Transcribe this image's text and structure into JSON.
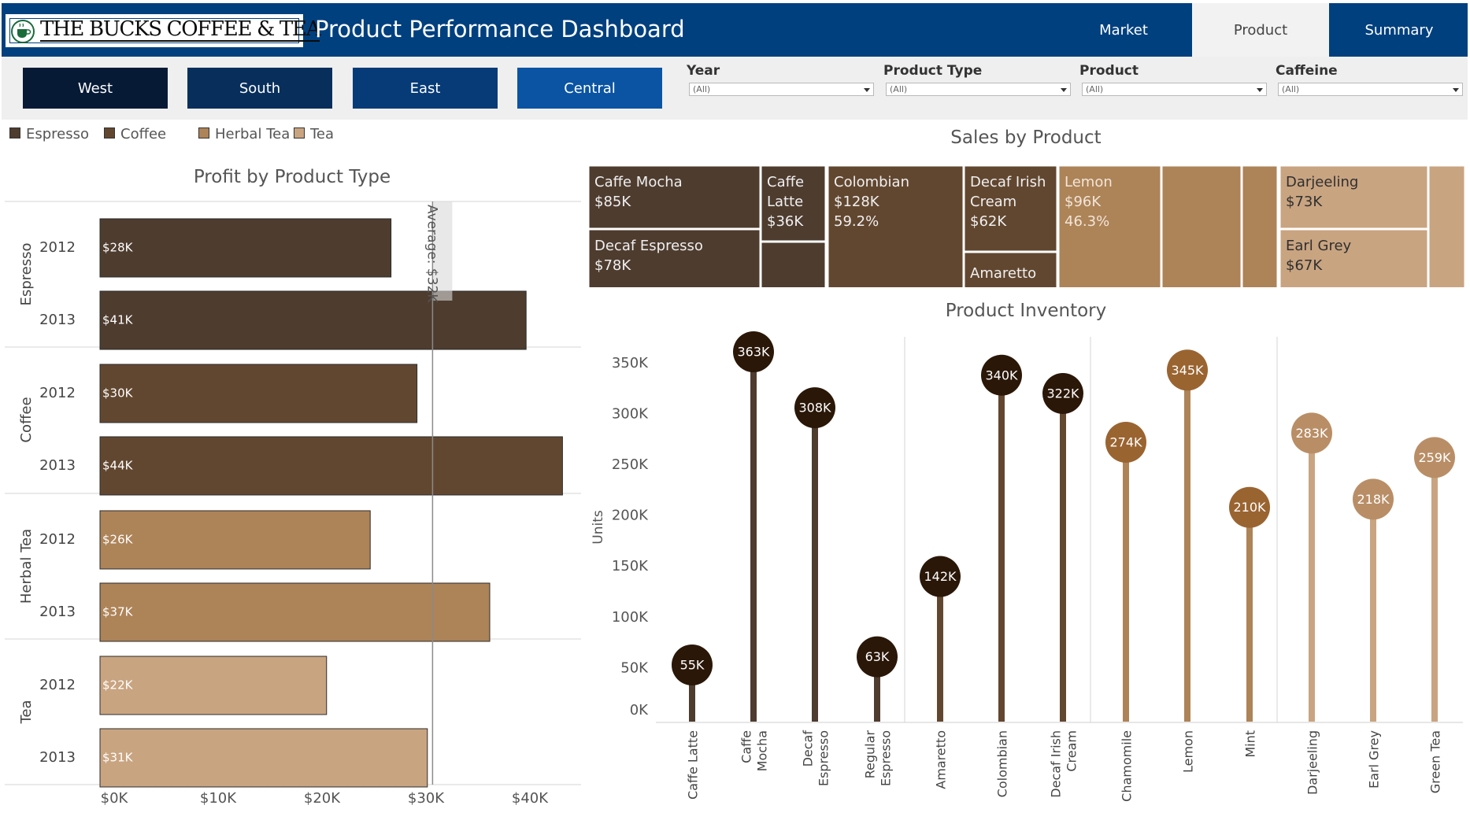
{
  "header": {
    "logo_text": "THE BUCKS COFFEE & TEA",
    "title": "Product Performance Dashboard",
    "tabs": [
      {
        "label": "Market",
        "active": false
      },
      {
        "label": "Product",
        "active": true
      },
      {
        "label": "Summary",
        "active": false
      }
    ]
  },
  "regions": [
    {
      "label": "West",
      "color": "#061a36"
    },
    {
      "label": "South",
      "color": "#082f5c"
    },
    {
      "label": "East",
      "color": "#063b78"
    },
    {
      "label": "Central",
      "color": "#0a54a3"
    }
  ],
  "filters": [
    {
      "label": "Year",
      "value": "(All)"
    },
    {
      "label": "Product Type",
      "value": "(All)"
    },
    {
      "label": "Product",
      "value": "(All)"
    },
    {
      "label": "Caffeine",
      "value": "(All)"
    }
  ],
  "legend": [
    {
      "label": "Espresso",
      "color": "#4e3c2f"
    },
    {
      "label": "Coffee",
      "color": "#624730"
    },
    {
      "label": "Herbal Tea",
      "color": "#ad8358"
    },
    {
      "label": "Tea",
      "color": "#c9a481"
    }
  ],
  "profit_chart": {
    "title": "Profit by Product Type",
    "average_label": "Average: $32K",
    "average_value": 32,
    "x_ticks": [
      "$0K",
      "$10K",
      "$20K",
      "$30K",
      "$40K"
    ],
    "x_tick_values": [
      0,
      10,
      20,
      30,
      40
    ],
    "groups": [
      {
        "name": "Espresso",
        "color": "#4e3c2f",
        "rows": [
          {
            "year": "2012",
            "value": 28,
            "label": "$28K"
          },
          {
            "year": "2013",
            "value": 41,
            "label": "$41K"
          }
        ]
      },
      {
        "name": "Coffee",
        "color": "#624730",
        "rows": [
          {
            "year": "2012",
            "value": 30.5,
            "label": "$30K"
          },
          {
            "year": "2013",
            "value": 44.5,
            "label": "$44K"
          }
        ]
      },
      {
        "name": "Herbal Tea",
        "color": "#ad8358",
        "rows": [
          {
            "year": "2012",
            "value": 26,
            "label": "$26K"
          },
          {
            "year": "2013",
            "value": 37.5,
            "label": "$37K"
          }
        ]
      },
      {
        "name": "Tea",
        "color": "#c9a481",
        "rows": [
          {
            "year": "2012",
            "value": 21.8,
            "label": "$22K"
          },
          {
            "year": "2013",
            "value": 31.5,
            "label": "$31K"
          }
        ]
      }
    ]
  },
  "sales_chart": {
    "title": "Sales by Product",
    "cells": [
      {
        "name": "Caffe Mocha",
        "value": "$85K",
        "extra": "",
        "color": "#4e3c2f"
      },
      {
        "name": "Decaf Espresso",
        "value": "$78K",
        "extra": "",
        "color": "#4e3c2f"
      },
      {
        "name": "Caffe Latte",
        "value": "$36K",
        "extra": "",
        "color": "#4e3c2f"
      },
      {
        "name": "",
        "value": "",
        "extra": "",
        "color": "#4e3c2f"
      },
      {
        "name": "Colombian",
        "value": "$128K",
        "extra": "59.2%",
        "color": "#624730"
      },
      {
        "name": "Decaf Irish Cream",
        "value": "$62K",
        "extra": "",
        "color": "#624730"
      },
      {
        "name": "Amaretto",
        "value": "",
        "extra": "",
        "color": "#624730"
      },
      {
        "name": "Lemon",
        "value": "$96K",
        "extra": "46.3%",
        "color": "#ad8358"
      },
      {
        "name": "",
        "value": "",
        "extra": "",
        "color": "#ad8358"
      },
      {
        "name": "",
        "value": "",
        "extra": "",
        "color": "#ad8358"
      },
      {
        "name": "Darjeeling",
        "value": "$73K",
        "extra": "",
        "color": "#c9a481"
      },
      {
        "name": "Earl Grey",
        "value": "$67K",
        "extra": "",
        "color": "#c9a481"
      },
      {
        "name": "",
        "value": "",
        "extra": "",
        "color": "#c9a481"
      }
    ]
  },
  "chart_data": {
    "type": "scatter",
    "title": "Product Inventory",
    "ylabel": "Units",
    "ylim": [
      0,
      370000
    ],
    "y_ticks": [
      "0K",
      "50K",
      "100K",
      "150K",
      "200K",
      "250K",
      "300K",
      "350K"
    ],
    "y_tick_values": [
      0,
      50000,
      100000,
      150000,
      200000,
      250000,
      300000,
      350000
    ],
    "grid": false,
    "series": [
      {
        "category": "Espresso",
        "stem_color": "#4e3c2f",
        "points": [
          {
            "x": "Caffe Latte",
            "value": 55000,
            "label": "55K",
            "dot": "#2a1708"
          },
          {
            "x": "Caffe Mocha",
            "value": 363000,
            "label": "363K",
            "dot": "#2a1708"
          },
          {
            "x": "Decaf Espresso",
            "value": 308000,
            "label": "308K",
            "dot": "#2a1708"
          },
          {
            "x": "Regular Espresso",
            "value": 63000,
            "label": "63K",
            "dot": "#2a1708"
          }
        ]
      },
      {
        "category": "Coffee",
        "stem_color": "#624730",
        "points": [
          {
            "x": "Amaretto",
            "value": 142000,
            "label": "142K",
            "dot": "#2a1708"
          },
          {
            "x": "Colombian",
            "value": 340000,
            "label": "340K",
            "dot": "#2a1708"
          },
          {
            "x": "Decaf Irish Cream",
            "value": 322000,
            "label": "322K",
            "dot": "#2a1708"
          }
        ]
      },
      {
        "category": "Herbal Tea",
        "stem_color": "#ad8358",
        "points": [
          {
            "x": "Chamomile",
            "value": 274000,
            "label": "274K",
            "dot": "#9a6431"
          },
          {
            "x": "Lemon",
            "value": 345000,
            "label": "345K",
            "dot": "#9a6431"
          },
          {
            "x": "Mint",
            "value": 210000,
            "label": "210K",
            "dot": "#9a6431"
          }
        ]
      },
      {
        "category": "Tea",
        "stem_color": "#c9a481",
        "points": [
          {
            "x": "Darjeeling",
            "value": 283000,
            "label": "283K",
            "dot": "#b98e66"
          },
          {
            "x": "Earl Grey",
            "value": 218000,
            "label": "218K",
            "dot": "#b98e66"
          },
          {
            "x": "Green Tea",
            "value": 259000,
            "label": "259K",
            "dot": "#b98e66"
          }
        ]
      }
    ],
    "x_labels": [
      [
        "Caffe Latte"
      ],
      [
        "Caffe",
        "Mocha"
      ],
      [
        "Decaf",
        "Espresso"
      ],
      [
        "Regular",
        "Espresso"
      ],
      [
        "Amaretto"
      ],
      [
        "Colombian"
      ],
      [
        "Decaf Irish",
        "Cream"
      ],
      [
        "Chamomile"
      ],
      [
        "Lemon"
      ],
      [
        "Mint"
      ],
      [
        "Darjeeling"
      ],
      [
        "Earl Grey"
      ],
      [
        "Green Tea"
      ]
    ]
  }
}
